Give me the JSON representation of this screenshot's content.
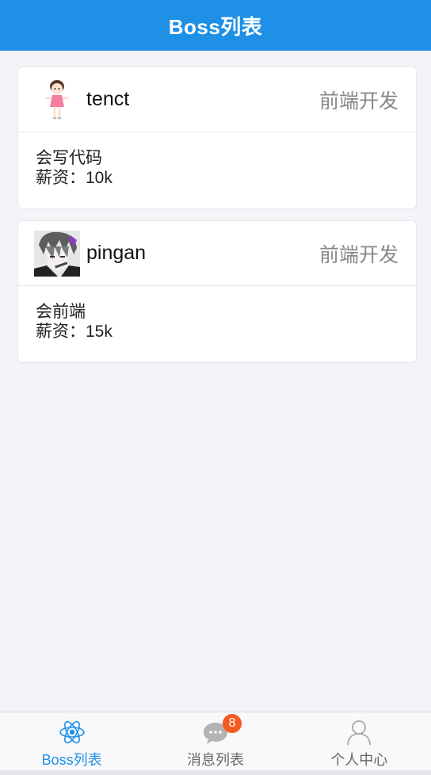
{
  "navbar": {
    "title": "Boss列表"
  },
  "cards": [
    {
      "name": "tenct",
      "position": "前端开发",
      "desc": "会写代码",
      "salary": "薪资：10k",
      "avatar_icon": "cartoon-girl-avatar"
    },
    {
      "name": "pingan",
      "position": "前端开发",
      "desc": "会前端",
      "salary": "薪资：15k",
      "avatar_icon": "anime-boy-avatar"
    }
  ],
  "tabbar": {
    "items": [
      {
        "label": "Boss列表",
        "icon": "atom-icon",
        "active": true
      },
      {
        "label": "消息列表",
        "icon": "chat-bubble-icon",
        "badge": "8"
      },
      {
        "label": "个人中心",
        "icon": "user-icon"
      }
    ]
  },
  "colors": {
    "primary": "#1e90e6",
    "badge": "#f55a1f",
    "background": "#f4f4f8"
  }
}
